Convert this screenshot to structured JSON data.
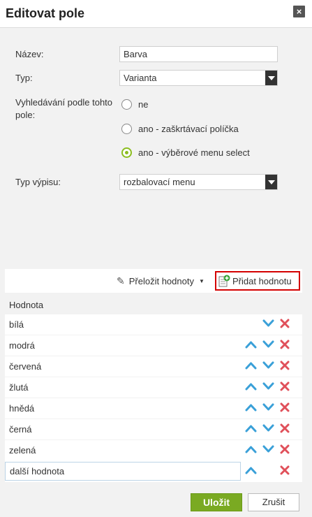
{
  "dialog": {
    "title": "Editovat pole",
    "close_symbol": "×"
  },
  "form": {
    "name_label": "Název:",
    "name_value": "Barva",
    "type_label": "Typ:",
    "type_value": "Varianta",
    "search_label": "Vyhledávání podle tohto pole:",
    "search_options": [
      {
        "label": "ne",
        "checked": false
      },
      {
        "label": "ano - zaškrtávací políčka",
        "checked": false
      },
      {
        "label": "ano - výběrové menu select",
        "checked": true
      }
    ],
    "listing_label": "Typ výpisu:",
    "listing_value": "rozbalovací menu"
  },
  "toolbar": {
    "translate_label": "Přeložit hodnoty",
    "add_label": "Přidat hodnotu"
  },
  "values_table": {
    "header": "Hodnota",
    "rows": [
      {
        "value": "bílá",
        "up": false,
        "down": true
      },
      {
        "value": "modrá",
        "up": true,
        "down": true
      },
      {
        "value": "červená",
        "up": true,
        "down": true
      },
      {
        "value": "žlutá",
        "up": true,
        "down": true
      },
      {
        "value": "hnědá",
        "up": true,
        "down": true
      },
      {
        "value": "černá",
        "up": true,
        "down": true
      },
      {
        "value": "zelená",
        "up": true,
        "down": true
      }
    ],
    "new_value": "další hodnota"
  },
  "footer": {
    "save_label": "Uložit",
    "cancel_label": "Zrušit"
  },
  "colors": {
    "accent_green": "#7aaa22",
    "arrow_blue": "#3aa0d8",
    "delete_red": "#e0505a",
    "highlight_red": "#d40000"
  }
}
